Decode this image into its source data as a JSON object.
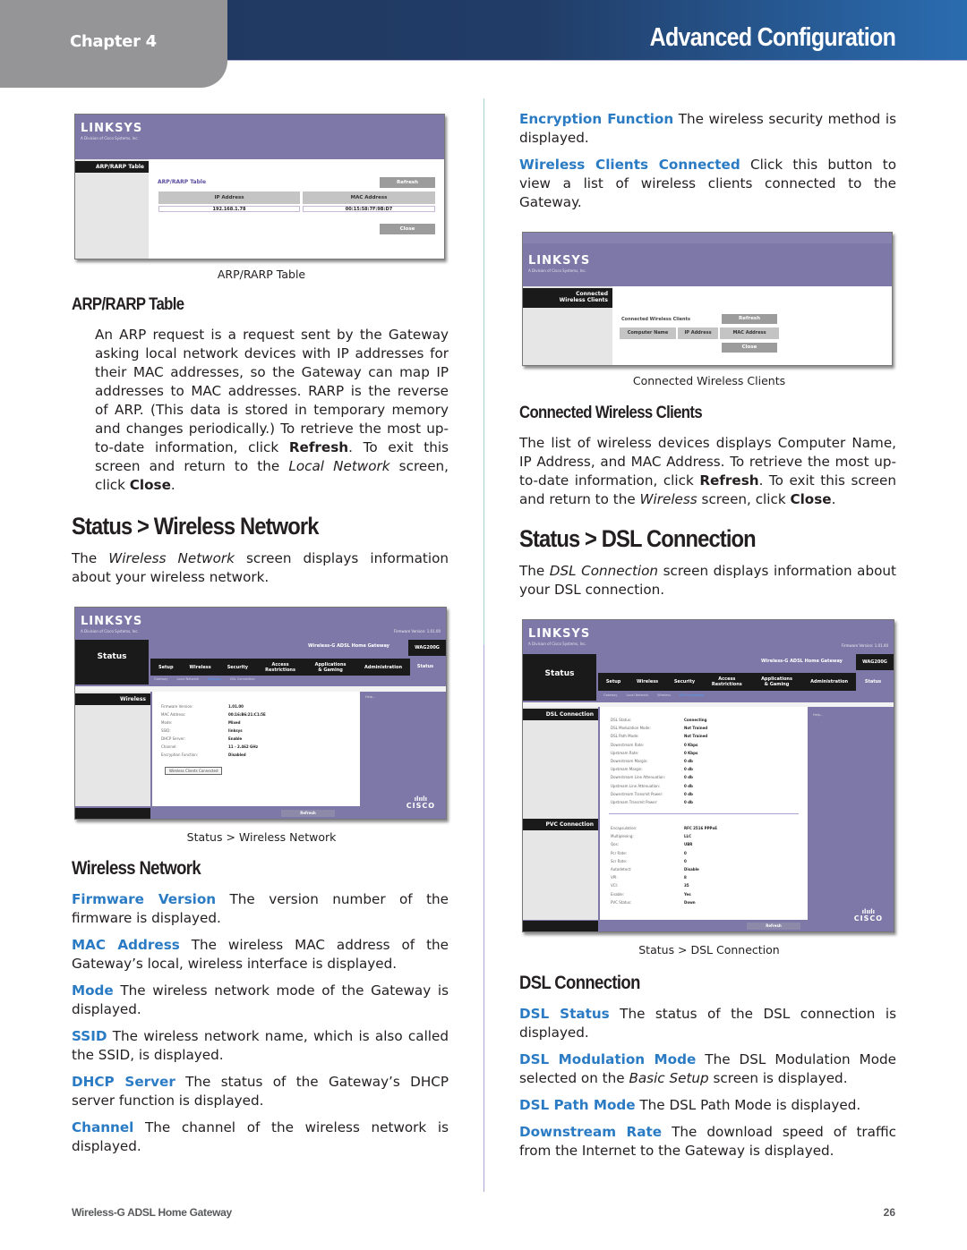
{
  "header": {
    "chapter": "Chapter 4",
    "title": "Advanced Configuration"
  },
  "left": {
    "arp_figure": {
      "logo": "LINKSYS",
      "logo_sub": "A Division of Cisco Systems, Inc.",
      "side_label": "ARP/RARP Table",
      "table_title": "ARP/RARP Table",
      "refresh": "Refresh",
      "close": "Close",
      "columns": [
        "IP Address",
        "MAC Address"
      ],
      "rows": [
        [
          "192.168.1.78",
          "00:15:58:7F:9B:D7"
        ]
      ],
      "caption": "ARP/RARP Table"
    },
    "arp_heading": "ARP/RARP Table",
    "arp_para": {
      "t1": "An ARP request is a request sent by the Gateway asking local network devices with IP addresses for their MAC addresses, so the Gateway can map IP addresses to MAC addresses. RARP is the reverse of ARP. (This data is stored in temporary memory and changes periodically.) To retrieve the most up-to-date information, click ",
      "b1": "Refresh",
      "t2": ". To exit this screen and return to the ",
      "i1": "Local Network",
      "t3": " screen, click ",
      "b2": "Close",
      "t4": "."
    },
    "wireless_section_title": "Status > Wireless Network",
    "wireless_intro": {
      "t1": "The ",
      "i1": "Wireless Network",
      "t2": " screen displays information about your wireless network."
    },
    "wireless_figure": {
      "logo": "LINKSYS",
      "logo_sub": "A Division of Cisco Systems, Inc.",
      "firmware_label": "Firmware Version: 1.01.00",
      "product": "Wireless-G ADSL Home Gateway",
      "model": "WAG200G",
      "section": "Status",
      "tabs": [
        "Setup",
        "Wireless",
        "Security",
        "Access Restrictions",
        "Applications & Gaming",
        "Administration",
        "Status"
      ],
      "subtabs": [
        "Gateway",
        "Local Network",
        "Wireless",
        "DSL Connection"
      ],
      "side_label": "Wireless",
      "help": "Help...",
      "fields": [
        {
          "label": "Firmware Version:",
          "value": "1.01.00"
        },
        {
          "label": "MAC Address:",
          "value": "00:16:B6:21:C1:5E"
        },
        {
          "label": "Mode:",
          "value": "Mixed"
        },
        {
          "label": "SSID:",
          "value": "linksys"
        },
        {
          "label": "DHCP Server:",
          "value": "Enable"
        },
        {
          "label": "Channel:",
          "value": "11 - 2.462 GHz"
        },
        {
          "label": "Encryption Function:",
          "value": "Disabled"
        }
      ],
      "clients_button": "Wireless Clients Connected",
      "refresh": "Refresh",
      "cisco": "CISCO",
      "caption": "Status > Wireless Network"
    },
    "wireless_heading": "Wireless Network",
    "wireless_terms": [
      {
        "term": "Firmware Version",
        "desc": "The version number of the firmware is displayed."
      },
      {
        "term": "MAC Address",
        "desc": "The wireless MAC address of the Gateway’s local, wireless interface is displayed."
      },
      {
        "term": "Mode",
        "desc": "The wireless network mode of the Gateway is displayed."
      },
      {
        "term": "SSID",
        "desc": "The wireless network name, which is also called the SSID, is displayed."
      },
      {
        "term": "DHCP Server",
        "desc": "The status of the Gateway’s DHCP server function is displayed."
      },
      {
        "term": "Channel",
        "desc": "The channel of the wireless network is displayed."
      }
    ]
  },
  "right": {
    "top_terms": [
      {
        "term": "Encryption Function",
        "desc": "The wireless security method is displayed."
      },
      {
        "term": "Wireless Clients Connected",
        "desc": "Click this button to view a list of wireless clients connected to the Gateway."
      }
    ],
    "clients_figure": {
      "logo": "LINKSYS",
      "logo_sub": "A Division of Cisco Systems, Inc.",
      "side_label": "Connected Wireless Clients",
      "table_title": "Connected Wireless Clients",
      "refresh": "Refresh",
      "close": "Close",
      "columns": [
        "Computer Name",
        "IP Address",
        "MAC Address"
      ],
      "caption": "Connected Wireless Clients"
    },
    "clients_heading": "Connected Wireless Clients",
    "clients_para": {
      "t1": "The list of wireless devices displays Computer Name, IP Address, and MAC Address. To retrieve the most up-to-date information, click ",
      "b1": "Refresh",
      "t2": ". To exit this screen and return to the ",
      "i1": "Wireless",
      "t3": " screen, click ",
      "b2": "Close",
      "t4": "."
    },
    "dsl_section_title": "Status > DSL Connection",
    "dsl_intro": {
      "t1": "The ",
      "i1": "DSL Connection",
      "t2": " screen displays information about your DSL connection."
    },
    "dsl_figure": {
      "logo": "LINKSYS",
      "logo_sub": "A Division of Cisco Systems, Inc.",
      "firmware_label": "Firmware Version: 1.01.00",
      "product": "Wireless-G ADSL Home Gateway",
      "model": "WAG200G",
      "section": "Status",
      "tabs": [
        "Setup",
        "Wireless",
        "Security",
        "Access Restrictions",
        "Applications & Gaming",
        "Administration",
        "Status"
      ],
      "subtabs": [
        "Gateway",
        "Local Network",
        "Wireless",
        "DSL Connection"
      ],
      "side_dsl": "DSL Connection",
      "side_pvc": "PVC Connection",
      "help": "Help...",
      "dsl_fields": [
        {
          "label": "DSL Status:",
          "value": "Connecting"
        },
        {
          "label": "DSL Modulation Mode:",
          "value": "Not Trained"
        },
        {
          "label": "DSL Path Mode:",
          "value": "Not Trained"
        },
        {
          "label": "Downstream Rate:",
          "value": "0 Kbps"
        },
        {
          "label": "Upstream Rate:",
          "value": "0 Kbps"
        },
        {
          "label": "Downstream Margin:",
          "value": "0 db"
        },
        {
          "label": "Upstream Margin:",
          "value": "0 db"
        },
        {
          "label": "Downstream Line Attenuation:",
          "value": "0 db"
        },
        {
          "label": "Upstream Line Attenuation:",
          "value": "0 db"
        },
        {
          "label": "Downstream Transmit Power:",
          "value": "0 db"
        },
        {
          "label": "Upstream Transmit Power:",
          "value": "0 db"
        }
      ],
      "pvc_fields": [
        {
          "label": "Encapsulation:",
          "value": "RFC 2516 PPPoE"
        },
        {
          "label": "Multiplexing:",
          "value": "LLC"
        },
        {
          "label": "Qos:",
          "value": "UBR"
        },
        {
          "label": "Pcr Rate:",
          "value": "0"
        },
        {
          "label": "Scr Rate:",
          "value": "0"
        },
        {
          "label": "Autodetect:",
          "value": "Disable"
        },
        {
          "label": "VPI:",
          "value": "8"
        },
        {
          "label": "VCI:",
          "value": "35"
        },
        {
          "label": "Enable:",
          "value": "Yes"
        },
        {
          "label": "PVC Status:",
          "value": "Down"
        }
      ],
      "refresh": "Refresh",
      "cisco": "CISCO",
      "caption": "Status > DSL Connection"
    },
    "dsl_heading": "DSL Connection",
    "dsl_terms": [
      {
        "term": "DSL Status",
        "desc": "The status of the DSL connection is displayed."
      },
      {
        "term": "DSL Modulation Mode",
        "desc_pre": "The DSL Modulation Mode selected on the ",
        "desc_i": "Basic Setup",
        "desc_post": " screen is displayed."
      },
      {
        "term": "DSL Path Mode",
        "desc": "The DSL Path Mode is displayed."
      },
      {
        "term": "Downstream Rate",
        "desc": "The download speed of traffic from the Internet to the Gateway is displayed."
      }
    ]
  },
  "footer": {
    "product": "Wireless-G ADSL Home Gateway",
    "page": "26"
  }
}
